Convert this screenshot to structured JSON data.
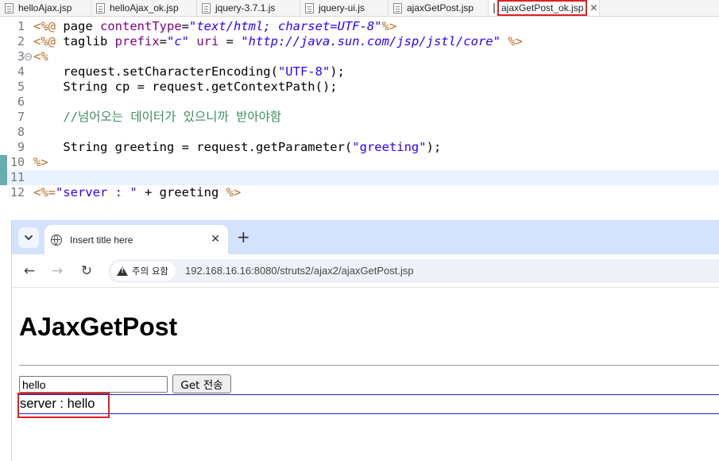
{
  "editor_tabs": [
    {
      "name": "helloAjax.jsp"
    },
    {
      "name": "helloAjax_ok.jsp"
    },
    {
      "name": "jquery-3.7.1.js"
    },
    {
      "name": "jquery-ui.js"
    },
    {
      "name": "ajaxGetPost.jsp"
    },
    {
      "name": "ajaxGetPost_ok.jsp"
    }
  ],
  "editor_tab_close": "✕",
  "code": {
    "line_numbers": [
      "1",
      "2",
      "3",
      "4",
      "5",
      "6",
      "7",
      "8",
      "9",
      "10",
      "11",
      "12"
    ],
    "l1": {
      "a": "<%@",
      "b": " page ",
      "c": "contentType",
      "d": "=",
      "e": "\"text/html; charset=UTF-8\"",
      "f": "%>"
    },
    "l2": {
      "a": "<%@",
      "b": " taglib ",
      "c": "prefix",
      "d": "=",
      "e": "\"c\"",
      "f": " uri",
      "g": " = ",
      "h": "\"http://java.sun.com/jsp/jstl/core\"",
      "i": " %>"
    },
    "l3": {
      "a": "<%"
    },
    "l4": {
      "a": "    request.setCharacterEncoding(",
      "b": "\"UTF-8\"",
      "c": ");"
    },
    "l5": {
      "a": "    String cp = request.getContextPath();"
    },
    "l7": {
      "a": "    //넘어오는 데이터가 있으니까 받아야함"
    },
    "l9": {
      "a": "    String greeting = request.getParameter(",
      "b": "\"greeting\"",
      "c": ");"
    },
    "l10": {
      "a": "%>"
    },
    "l12": {
      "a": "<%=",
      "b": "\"server : \"",
      "c": " + greeting ",
      "d": "%>"
    }
  },
  "browser": {
    "tab_title": "Insert title here",
    "tab_close": "✕",
    "new_tab": "+",
    "back": "←",
    "forward": "→",
    "reload": "↻",
    "security_chip": "주의 요함",
    "url": "192.168.16.16:8080/struts2/ajax2/ajaxGetPost.jsp"
  },
  "page": {
    "heading": "AJaxGetPost",
    "input_value": "hello",
    "button_label": "Get 전송",
    "result_text": "server : hello"
  },
  "colors": {
    "annotation_red": "#e02020",
    "jsp_tag": "#b86f2c",
    "string_blue": "#2a00ff",
    "comment_green": "#3f8f5f"
  }
}
